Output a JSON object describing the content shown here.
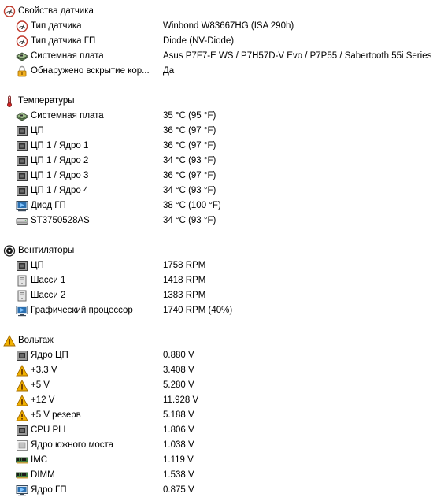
{
  "sections": [
    {
      "title": "Свойства датчика",
      "icon": "sensor-icon",
      "items": [
        {
          "field": "Тип датчика",
          "value": "Winbond W83667HG  (ISA 290h)",
          "icon": "sensor-icon"
        },
        {
          "field": "Тип датчика ГП",
          "value": "Diode  (NV-Diode)",
          "icon": "sensor-icon"
        },
        {
          "field": "Системная плата",
          "value": "Asus P7F7-E WS / P7H57D-V Evo / P7P55 / Sabertooth 55i Series",
          "icon": "motherboard-icon"
        },
        {
          "field": "Обнаружено вскрытие кор...",
          "value": "Да",
          "icon": "lock-icon"
        }
      ]
    },
    {
      "title": "Температуры",
      "icon": "thermometer-icon",
      "items": [
        {
          "field": "Системная плата",
          "value": "35 °C  (95 °F)",
          "icon": "motherboard-icon"
        },
        {
          "field": "ЦП",
          "value": "36 °C  (97 °F)",
          "icon": "cpu-icon"
        },
        {
          "field": "ЦП 1 / Ядро 1",
          "value": "36 °C  (97 °F)",
          "icon": "cpu-icon"
        },
        {
          "field": "ЦП 1 / Ядро 2",
          "value": "34 °C  (93 °F)",
          "icon": "cpu-icon"
        },
        {
          "field": "ЦП 1 / Ядро 3",
          "value": "36 °C  (97 °F)",
          "icon": "cpu-icon"
        },
        {
          "field": "ЦП 1 / Ядро 4",
          "value": "34 °C  (93 °F)",
          "icon": "cpu-icon"
        },
        {
          "field": "Диод ГП",
          "value": "38 °C  (100 °F)",
          "icon": "gpu-icon"
        },
        {
          "field": "ST3750528AS",
          "value": "34 °C  (93 °F)",
          "icon": "hdd-icon"
        }
      ]
    },
    {
      "title": "Вентиляторы",
      "icon": "fan-icon",
      "items": [
        {
          "field": "ЦП",
          "value": "1758 RPM",
          "icon": "cpu-icon"
        },
        {
          "field": "Шасси 1",
          "value": "1418 RPM",
          "icon": "chassis-icon"
        },
        {
          "field": "Шасси 2",
          "value": "1383 RPM",
          "icon": "chassis-icon"
        },
        {
          "field": "Графический процессор",
          "value": "1740 RPM  (40%)",
          "icon": "gpu-icon"
        }
      ]
    },
    {
      "title": "Вольтаж",
      "icon": "warning-icon",
      "items": [
        {
          "field": "Ядро ЦП",
          "value": "0.880 V",
          "icon": "cpu-icon"
        },
        {
          "field": "+3.3 V",
          "value": "3.408 V",
          "icon": "warning-icon"
        },
        {
          "field": "+5 V",
          "value": "5.280 V",
          "icon": "warning-icon"
        },
        {
          "field": "+12 V",
          "value": "11.928 V",
          "icon": "warning-icon"
        },
        {
          "field": "+5 V резерв",
          "value": "5.188 V",
          "icon": "warning-icon"
        },
        {
          "field": "CPU PLL",
          "value": "1.806 V",
          "icon": "cpu-icon"
        },
        {
          "field": "Ядро южного моста",
          "value": "1.038 V",
          "icon": "chip-icon"
        },
        {
          "field": "IMC",
          "value": "1.119 V",
          "icon": "memory-icon"
        },
        {
          "field": "DIMM",
          "value": "1.538 V",
          "icon": "memory-icon"
        },
        {
          "field": "Ядро ГП",
          "value": "0.875 V",
          "icon": "gpu-icon"
        }
      ]
    }
  ]
}
